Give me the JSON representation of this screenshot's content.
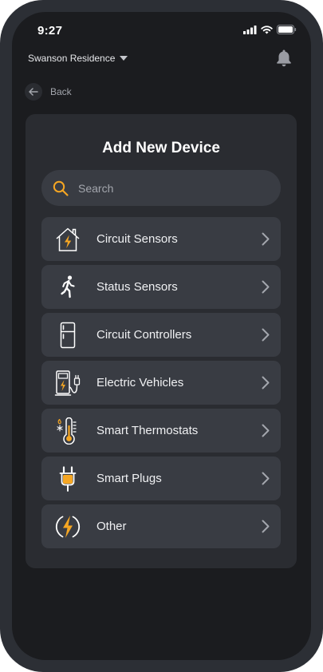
{
  "status_bar": {
    "time": "9:27"
  },
  "header": {
    "residence": "Swanson Residence"
  },
  "nav": {
    "back_label": "Back"
  },
  "dialog": {
    "title": "Add New Device",
    "search_placeholder": "Search"
  },
  "devices": [
    {
      "label": "Circuit Sensors",
      "icon": "house-bolt-icon"
    },
    {
      "label": "Status Sensors",
      "icon": "walking-person-icon"
    },
    {
      "label": "Circuit Controllers",
      "icon": "refrigerator-icon"
    },
    {
      "label": "Electric Vehicles",
      "icon": "ev-charger-icon"
    },
    {
      "label": "Smart Thermostats",
      "icon": "thermometer-icon"
    },
    {
      "label": "Smart Plugs",
      "icon": "plug-icon"
    },
    {
      "label": "Other",
      "icon": "bolt-circle-icon"
    }
  ],
  "colors": {
    "accent": "#f5a623",
    "background": "#1b1c1f",
    "card": "#2a2c31",
    "item": "#393c43",
    "frame": "#2c2f35"
  }
}
